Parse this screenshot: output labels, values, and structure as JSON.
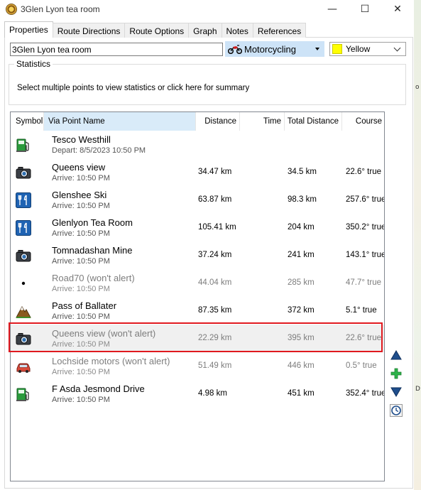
{
  "window": {
    "title": "3Glen Lyon tea room",
    "minimize": "—",
    "maximize": "☐",
    "close": "✕"
  },
  "tabs": [
    "Properties",
    "Route Directions",
    "Route Options",
    "Graph",
    "Notes",
    "References"
  ],
  "route": {
    "name": "3Glen Lyon tea room",
    "vehicle": "Motorcycling",
    "color_label": "Yellow",
    "color_value": "#ffff00"
  },
  "statistics": {
    "legend": "Statistics",
    "text": "Select multiple points to view statistics or click here for summary"
  },
  "columns": {
    "symbol": "Symbol",
    "via_point_name": "Via Point Name",
    "distance": "Distance",
    "time": "Time",
    "total_distance": "Total Distance",
    "course": "Course"
  },
  "rows": [
    {
      "icon": "fuel-icon",
      "name": "Tesco Westhill",
      "sub": "Depart: 8/5/2023 10:50 PM",
      "distance": "",
      "total": "",
      "course": "",
      "muted": false
    },
    {
      "icon": "camera-icon",
      "name": "Queens view",
      "sub": "Arrive: 10:50 PM",
      "distance": "34.47 km",
      "total": "34.5 km",
      "course": "22.6° true",
      "muted": false
    },
    {
      "icon": "restaurant-icon",
      "name": "Glenshee Ski",
      "sub": "Arrive: 10:50 PM",
      "distance": "63.87 km",
      "total": "98.3 km",
      "course": "257.6° true",
      "muted": false
    },
    {
      "icon": "restaurant-icon",
      "name": "Glenlyon Tea Room",
      "sub": "Arrive: 10:50 PM",
      "distance": "105.41 km",
      "total": "204 km",
      "course": "350.2° true",
      "muted": false
    },
    {
      "icon": "camera-icon",
      "name": "Tomnadashan Mine",
      "sub": "Arrive: 10:50 PM",
      "distance": "37.24 km",
      "total": "241 km",
      "course": "143.1° true",
      "muted": false
    },
    {
      "icon": "dot-icon",
      "name": "Road70 (won't alert)",
      "sub": "Arrive: 10:50 PM",
      "distance": "44.04 km",
      "total": "285 km",
      "course": "47.7° true",
      "muted": true
    },
    {
      "icon": "mountain-icon",
      "name": "Pass of Ballater",
      "sub": "Arrive: 10:50 PM",
      "distance": "87.35 km",
      "total": "372 km",
      "course": "5.1° true",
      "muted": false
    },
    {
      "icon": "camera-icon",
      "name": "Queens view (won't alert)",
      "sub": "Arrive: 10:50 PM",
      "distance": "22.29 km",
      "total": "395 km",
      "course": "22.6° true",
      "muted": true,
      "selected": true
    },
    {
      "icon": "car-icon",
      "name": "Lochside motors (won't alert)",
      "sub": "Arrive: 10:50 PM",
      "distance": "51.49 km",
      "total": "446 km",
      "course": "0.5° true",
      "muted": true
    },
    {
      "icon": "fuel-icon",
      "name": "F Asda Jesmond Drive",
      "sub": "Arrive: 10:50 PM",
      "distance": "4.98 km",
      "total": "451 km",
      "course": "352.4° true",
      "muted": false
    }
  ]
}
